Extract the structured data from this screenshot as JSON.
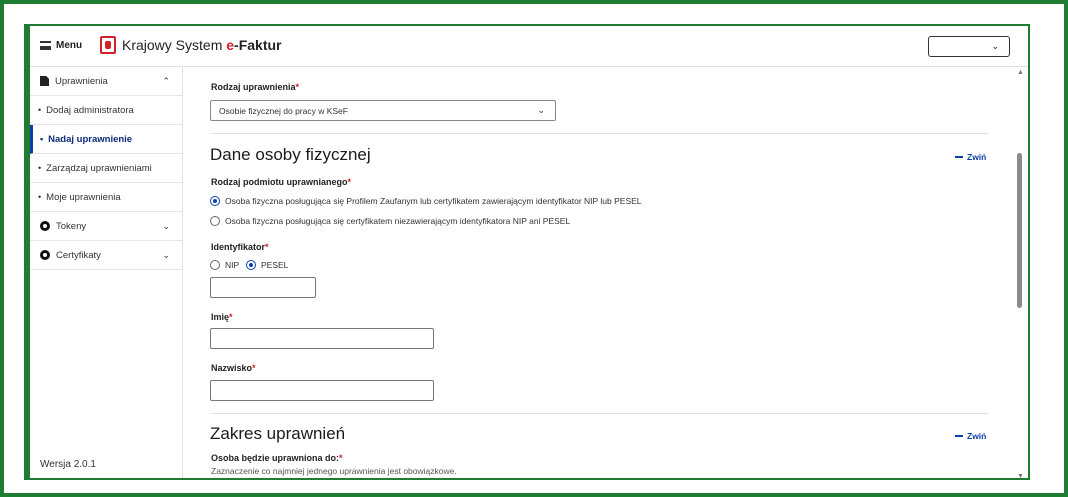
{
  "header": {
    "menu_label": "Menu",
    "logo_prefix": "Krajowy System ",
    "logo_accent": "e",
    "logo_suffix": "-Faktur",
    "language_select_value": ""
  },
  "sidebar": {
    "items": [
      {
        "label": "Uprawnienia",
        "icon": "document-icon",
        "expanded": true
      },
      {
        "label": "Dodaj administratora"
      },
      {
        "label": "Nadaj uprawnienie",
        "active": true
      },
      {
        "label": "Zarządzaj uprawnieniami"
      },
      {
        "label": "Moje uprawnienia"
      },
      {
        "label": "Tokeny",
        "icon": "ring-icon",
        "expanded": false
      },
      {
        "label": "Certyfikaty",
        "icon": "ring-icon",
        "expanded": false
      }
    ],
    "version": "Wersja 2.0.1"
  },
  "form": {
    "permission_type": {
      "label": "Rodzaj uprawnienia",
      "value": "Osobie fizycznej do pracy w KSeF"
    },
    "person_section": {
      "title": "Dane osoby fizycznej",
      "collapse_label": "Zwiń",
      "subject_type_label": "Rodzaj podmiotu uprawnianego",
      "subject_options": [
        "Osoba fizyczna posługująca się Profilem Zaufanym lub certyfikatem zawierającym identyfikator NIP lub PESEL",
        "Osoba fizyczna posługująca się certyfikatem niezawierającym identyfikatora NIP ani PESEL"
      ],
      "subject_selected": 0,
      "identifier_label": "Identyfikator",
      "identifier_options": [
        "NIP",
        "PESEL"
      ],
      "identifier_selected": 1,
      "identifier_value": "",
      "first_name_label": "Imię",
      "first_name_value": "",
      "last_name_label": "Nazwisko",
      "last_name_value": ""
    },
    "scope_section": {
      "title": "Zakres uprawnień",
      "collapse_label": "Zwiń",
      "authorized_label": "Osoba będzie uprawniona do:",
      "hint": "Zaznaczenie co najmniej jednego uprawnienia jest obowiązkowe."
    },
    "required_mark": "*"
  },
  "colors": {
    "frame": "#1e7d32",
    "accent_red": "#d3212c",
    "link_blue": "#0b3fa8"
  }
}
